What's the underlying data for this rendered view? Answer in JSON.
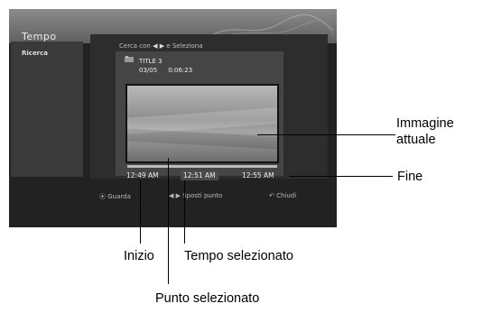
{
  "screen": {
    "title": "Tempo",
    "sidebar": {
      "item_label": "Ricerca"
    },
    "hint": {
      "prefix": "Cerca con",
      "arrows": "◀ ▶",
      "suffix": "e Seleziona"
    },
    "card": {
      "title": "TITLE 3",
      "date": "03/05",
      "duration": "0:06:23"
    },
    "times": {
      "start": "12:49 AM",
      "selected": "12:51 AM",
      "end": "12:55 AM"
    },
    "legend": {
      "watch": "⦿ Guarda",
      "move_point": "◀ ▶ Sposti punto",
      "close": "↶ Chiudi"
    }
  },
  "annotations": {
    "current_image": "Immagine\nattuale",
    "end": "Fine",
    "start": "Inizio",
    "selected_time": "Tempo selezionato",
    "selected_point": "Punto selezionato"
  },
  "colors": {
    "screen_bg": "#222222",
    "title_bar": "#7a7a7a",
    "text": "#eeeeee"
  }
}
